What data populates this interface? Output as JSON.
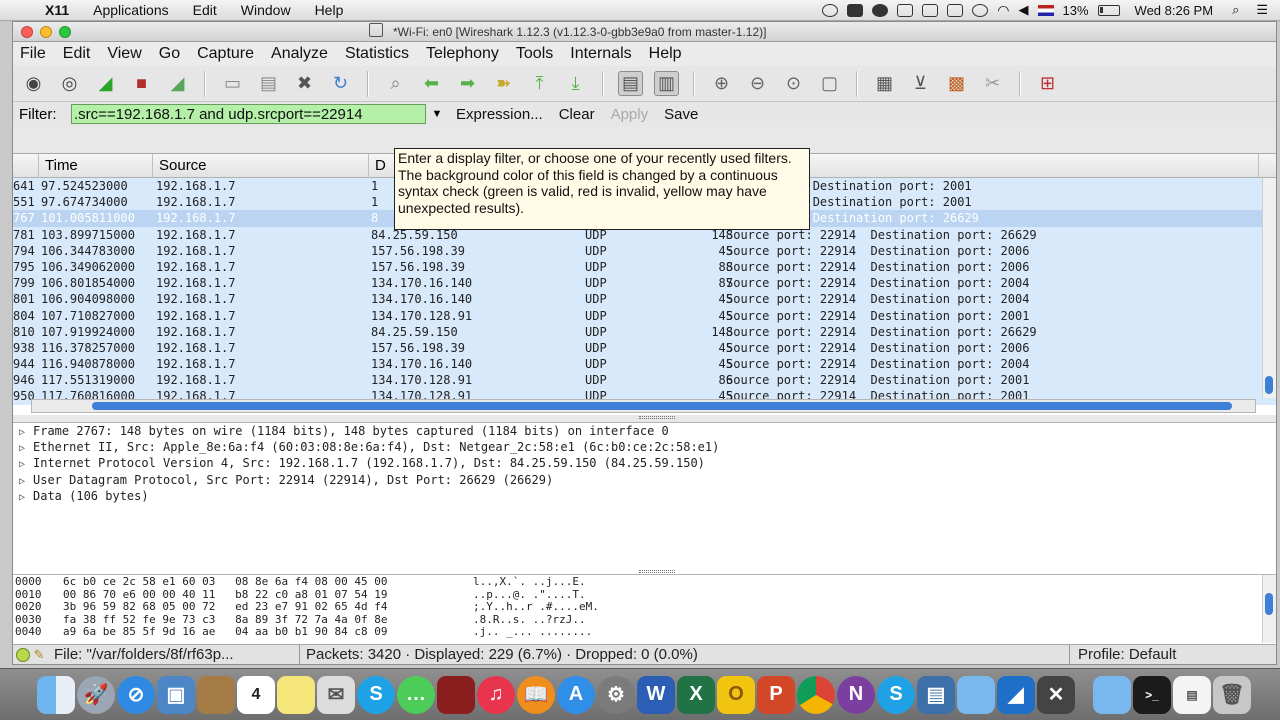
{
  "menubar": {
    "app": "X11",
    "items": [
      "Applications",
      "Edit",
      "Window",
      "Help"
    ],
    "battery": "13%",
    "clock": "Wed 8:26 PM"
  },
  "window": {
    "title": "*Wi-Fi: en0   [Wireshark 1.12.3  (v1.12.3-0-gbb3e9a0 from master-1.12)]"
  },
  "ws_menu": [
    "File",
    "Edit",
    "View",
    "Go",
    "Capture",
    "Analyze",
    "Statistics",
    "Telephony",
    "Tools",
    "Internals",
    "Help"
  ],
  "toolbar": {
    "icons": [
      "interfaces-icon",
      "options-icon",
      "start-capture-icon",
      "stop-capture-icon",
      "restart-capture-icon",
      "open-file-icon",
      "save-file-icon",
      "close-file-icon",
      "reload-icon",
      "find-packet-icon",
      "go-back-icon",
      "go-forward-icon",
      "go-to-packet-icon",
      "go-first-icon",
      "go-last-icon",
      "colorize-icon",
      "autoscroll-icon",
      "zoom-in-icon",
      "zoom-out-icon",
      "normal-size-icon",
      "resize-columns-icon",
      "capture-filters-icon",
      "display-filters-icon",
      "coloring-rules-icon",
      "preferences-icon",
      "help-icon"
    ]
  },
  "filter": {
    "label": "Filter:",
    "value": ".src==192.168.1.7 and udp.srcport==22914",
    "expression": "Expression...",
    "clear": "Clear",
    "apply": "Apply",
    "save": "Save",
    "tooltip": "Enter a display filter, or choose one of your recently used filters. The background color of this field is changed by a continuous syntax check (green is valid, red is invalid, yellow may have unexpected results)."
  },
  "packet_list": {
    "columns": [
      "Time",
      "Source",
      "D"
    ],
    "rows": [
      {
        "no": "641",
        "time": "97.524523000",
        "src": "192.168.1.7",
        "dst": "1",
        "proto": "",
        "len": "",
        "info": "ort: 22914  Destination port: 2001"
      },
      {
        "no": "551",
        "time": "97.674734000",
        "src": "192.168.1.7",
        "dst": "1",
        "proto": "",
        "len": "",
        "info": "ort: 22914  Destination port: 2001"
      },
      {
        "no": "767",
        "time": "101.005811000",
        "src": "192.168.1.7",
        "dst": "8",
        "proto": "",
        "len": "",
        "info": "ort: 22914  Destination port: 26629"
      },
      {
        "no": "781",
        "time": "103.899715000",
        "src": "192.168.1.7",
        "dst": "84.25.59.150",
        "proto": "UDP",
        "len": "148",
        "info": "Source port: 22914  Destination port: 26629"
      },
      {
        "no": "794",
        "time": "106.344783000",
        "src": "192.168.1.7",
        "dst": "157.56.198.39",
        "proto": "UDP",
        "len": "45",
        "info": "Source port: 22914  Destination port: 2006"
      },
      {
        "no": "795",
        "time": "106.349062000",
        "src": "192.168.1.7",
        "dst": "157.56.198.39",
        "proto": "UDP",
        "len": "88",
        "info": "Source port: 22914  Destination port: 2006"
      },
      {
        "no": "799",
        "time": "106.801854000",
        "src": "192.168.1.7",
        "dst": "134.170.16.140",
        "proto": "UDP",
        "len": "87",
        "info": "Source port: 22914  Destination port: 2004"
      },
      {
        "no": "801",
        "time": "106.904098000",
        "src": "192.168.1.7",
        "dst": "134.170.16.140",
        "proto": "UDP",
        "len": "45",
        "info": "Source port: 22914  Destination port: 2004"
      },
      {
        "no": "804",
        "time": "107.710827000",
        "src": "192.168.1.7",
        "dst": "134.170.128.91",
        "proto": "UDP",
        "len": "45",
        "info": "Source port: 22914  Destination port: 2001"
      },
      {
        "no": "810",
        "time": "107.919924000",
        "src": "192.168.1.7",
        "dst": "84.25.59.150",
        "proto": "UDP",
        "len": "148",
        "info": "Source port: 22914  Destination port: 26629"
      },
      {
        "no": "938",
        "time": "116.378257000",
        "src": "192.168.1.7",
        "dst": "157.56.198.39",
        "proto": "UDP",
        "len": "45",
        "info": "Source port: 22914  Destination port: 2006"
      },
      {
        "no": "944",
        "time": "116.940878000",
        "src": "192.168.1.7",
        "dst": "134.170.16.140",
        "proto": "UDP",
        "len": "45",
        "info": "Source port: 22914  Destination port: 2004"
      },
      {
        "no": "946",
        "time": "117.551319000",
        "src": "192.168.1.7",
        "dst": "134.170.128.91",
        "proto": "UDP",
        "len": "86",
        "info": "Source port: 22914  Destination port: 2001"
      },
      {
        "no": "950",
        "time": "117.760816000",
        "src": "192.168.1.7",
        "dst": "134.170.128.91",
        "proto": "UDP",
        "len": "45",
        "info": "Source port: 22914  Destination port: 2001"
      }
    ]
  },
  "details": [
    "Frame 2767: 148 bytes on wire (1184 bits), 148 bytes captured (1184 bits) on interface 0",
    "Ethernet II, Src: Apple_8e:6a:f4 (60:03:08:8e:6a:f4), Dst: Netgear_2c:58:e1 (6c:b0:ce:2c:58:e1)",
    "Internet Protocol Version 4, Src: 192.168.1.7 (192.168.1.7), Dst: 84.25.59.150 (84.25.59.150)",
    "User Datagram Protocol, Src Port: 22914 (22914), Dst Port: 26629 (26629)",
    "Data (106 bytes)"
  ],
  "hex": [
    {
      "off": "0000",
      "bytes": "6c b0 ce 2c 58 e1 60 03   08 8e 6a f4 08 00 45 00",
      "ascii": "l..,X.`. ..j...E."
    },
    {
      "off": "0010",
      "bytes": "00 86 70 e6 00 00 40 11   b8 22 c0 a8 01 07 54 19",
      "ascii": "..p...@. .\"....T."
    },
    {
      "off": "0020",
      "bytes": "3b 96 59 82 68 05 00 72   ed 23 e7 91 02 65 4d f4",
      "ascii": ";.Y..h..r .#....eM."
    },
    {
      "off": "0030",
      "bytes": "fa 38 ff 52 fe 9e 73 c3   8a 89 3f 72 7a 4a 0f 8e",
      "ascii": ".8.R..s. ..?rzJ.."
    },
    {
      "off": "0040",
      "bytes": "a9 6a be 85 5f 9d 16 ae   04 aa b0 b1 90 84 c8 09",
      "ascii": ".j.. _... ........"
    }
  ],
  "status": {
    "file": "File: \"/var/folders/8f/rf63p...",
    "packets": "Packets: 3420 · Displayed: 229 (6.7%)  · Dropped: 0 (0.0%)",
    "profile": "Profile: Default"
  },
  "dock": {
    "apps": [
      "finder-icon",
      "launchpad-icon",
      "safari-icon",
      "preview-icon",
      "notes-icon",
      "calendar-icon",
      "stickies-icon",
      "mail-icon",
      "skype-icon",
      "messages-icon",
      "photobooth-icon",
      "itunes-icon",
      "ibooks-icon",
      "appstore-icon",
      "syspref-icon",
      "word-icon",
      "excel-icon",
      "outlook-icon",
      "powerpoint-icon",
      "chrome-icon",
      "onenote-icon",
      "skype2-icon",
      "vmware-icon",
      "folder-icon",
      "wireshark-icon",
      "x11-icon",
      "downloads-icon",
      "terminal-icon",
      "document-icon",
      "trash-icon"
    ],
    "calendar_day": "4"
  },
  "colors": {
    "filter_ok": "#b4f0a8",
    "row_bg": "#d8e9fb",
    "selected_row": "#bad4f1",
    "scrollbar": "#3e7fd8"
  }
}
